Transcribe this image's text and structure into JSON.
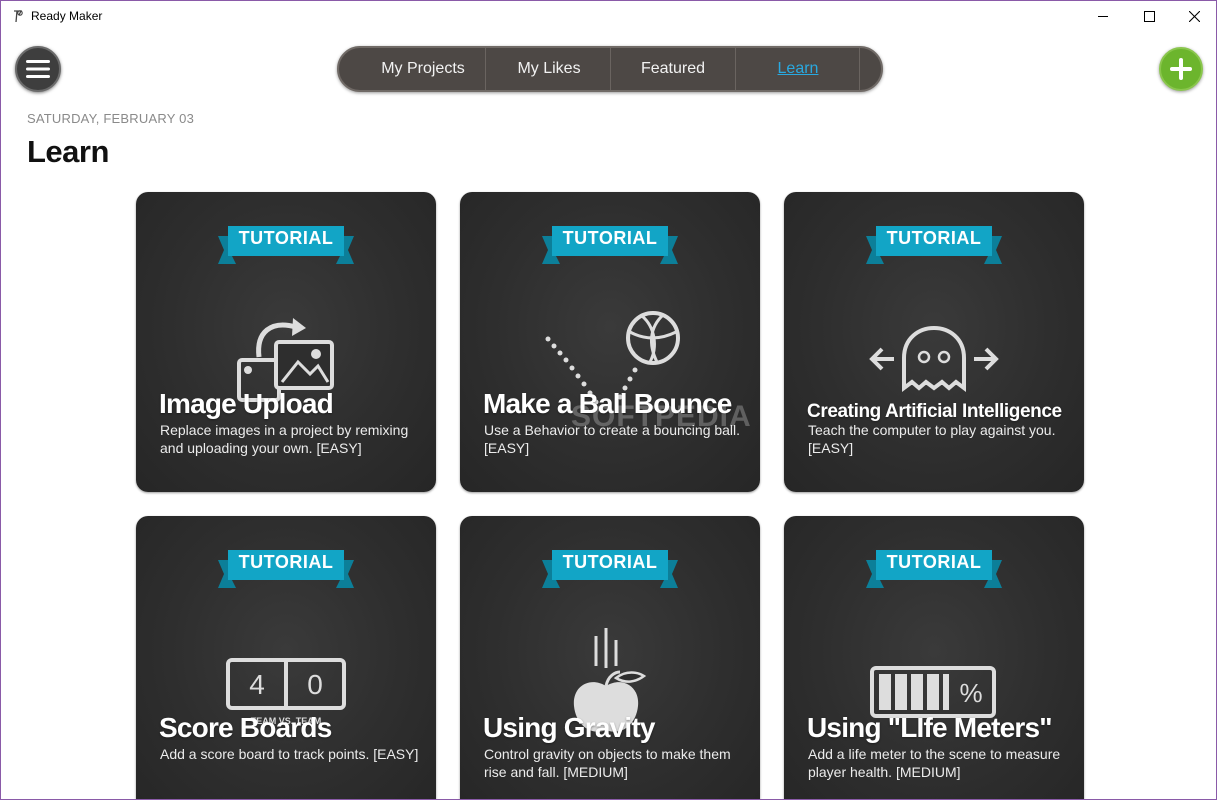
{
  "window": {
    "title": "Ready Maker"
  },
  "nav": {
    "tabs": [
      {
        "label": "My Projects"
      },
      {
        "label": "My Likes"
      },
      {
        "label": "Featured"
      },
      {
        "label": "Learn"
      }
    ],
    "active": "Learn"
  },
  "header": {
    "date": "SATURDAY, FEBRUARY 03",
    "title": "Learn"
  },
  "cards": [
    {
      "badge": "TUTORIAL",
      "title": "Image Upload",
      "description": "Replace images in a project by remixing and uploading your own. [EASY]",
      "icon": "image-upload-icon"
    },
    {
      "badge": "TUTORIAL",
      "title": "Make a Ball Bounce",
      "description": "Use a Behavior to create a bouncing ball. [EASY]",
      "icon": "bouncing-ball-icon"
    },
    {
      "badge": "TUTORIAL",
      "title": "Creating Artificial Intelligence",
      "description": "Teach the computer to play against you. [EASY]",
      "icon": "ghost-icon"
    },
    {
      "badge": "TUTORIAL",
      "title": "Score Boards",
      "description": "Add a score board to track points. [EASY]",
      "icon": "scoreboard-icon",
      "score_home": "4",
      "score_away": "0",
      "score_caption": "TEAM VS. TEAM"
    },
    {
      "badge": "TUTORIAL",
      "title": "Using Gravity",
      "description": "Control gravity on objects to make them rise and fall. [MEDIUM]",
      "icon": "falling-apple-icon"
    },
    {
      "badge": "TUTORIAL",
      "title": "Using \"LIfe Meters\"",
      "description": "Add a life meter to the scene to measure player health. [MEDIUM]",
      "icon": "life-meter-icon",
      "meter_symbol": "%"
    }
  ],
  "watermark": "SOFTPEDIA",
  "colors": {
    "accent_blue": "#29a9e0",
    "ribbon": "#12a5c6",
    "add_green": "#6cb52d",
    "card_bg": "#2e2e2e",
    "nav_bg": "#4d4845"
  }
}
